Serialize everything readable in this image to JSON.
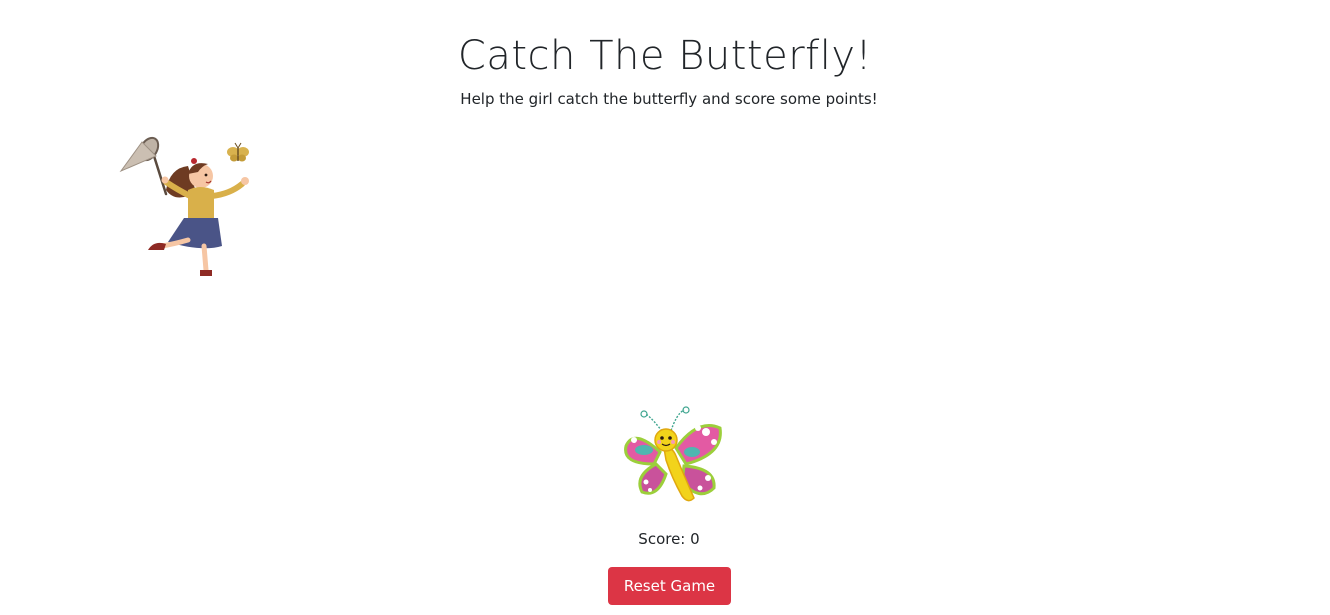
{
  "header": {
    "title": "Catch The Butterfly!",
    "subtitle": "Help the girl catch the butterfly and score some points!"
  },
  "game": {
    "player": "girl-with-net",
    "target": "butterfly",
    "score_text": "Score: 0",
    "score": 0
  },
  "controls": {
    "reset_label": "Reset Game"
  },
  "colors": {
    "reset_button": "#dc3545",
    "text": "#212529",
    "background": "#ffffff"
  }
}
